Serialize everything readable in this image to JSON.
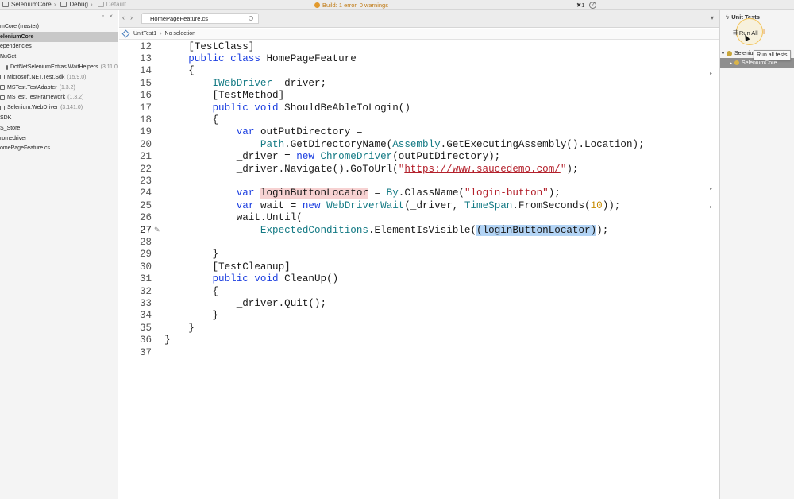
{
  "toolbar": {
    "solution": "SeleniumCore",
    "config": "Debug",
    "device": "Default",
    "build_status": "Build: 1 error, 0 warnings",
    "error_count": "1"
  },
  "solution_explorer": {
    "items": [
      {
        "label": "mCore (master)",
        "version": "",
        "indent": 0,
        "selected": false,
        "icon": ""
      },
      {
        "label": "eleniumCore",
        "version": "",
        "indent": 0,
        "selected": true,
        "icon": ""
      },
      {
        "label": "ependencies",
        "version": "",
        "indent": 0,
        "selected": false,
        "icon": ""
      },
      {
        "label": "NuGet",
        "version": "",
        "indent": 0,
        "selected": false,
        "icon": ""
      },
      {
        "label": "DotNetSeleniumExtras.WaitHelpers",
        "version": "(3.11.0)",
        "indent": 8,
        "selected": false,
        "icon": "package-icon"
      },
      {
        "label": "Microsoft.NET.Test.Sdk",
        "version": "(15.9.0)",
        "indent": 0,
        "selected": false,
        "icon": "package-icon"
      },
      {
        "label": "MSTest.TestAdapter",
        "version": "(1.3.2)",
        "indent": 0,
        "selected": false,
        "icon": "package-icon"
      },
      {
        "label": "MSTest.TestFramework",
        "version": "(1.3.2)",
        "indent": 0,
        "selected": false,
        "icon": "package-icon"
      },
      {
        "label": "Selenium.WebDriver",
        "version": "(3.141.0)",
        "indent": 0,
        "selected": false,
        "icon": "package-icon"
      },
      {
        "label": "SDK",
        "version": "",
        "indent": 0,
        "selected": false,
        "icon": ""
      },
      {
        "label": "S_Store",
        "version": "",
        "indent": 0,
        "selected": false,
        "icon": ""
      },
      {
        "label": "romedriver",
        "version": "",
        "indent": 0,
        "selected": false,
        "icon": ""
      },
      {
        "label": "omePageFeature.cs",
        "version": "",
        "indent": 0,
        "selected": false,
        "icon": ""
      }
    ]
  },
  "editor": {
    "tab_title": "HomePageFeature.cs",
    "breadcrumb": [
      "UnitTest1",
      "No selection"
    ],
    "current_line": 27,
    "lines": [
      {
        "n": "12",
        "code": [
          [
            "",
            "    "
          ],
          [
            "",
            "[TestClass]"
          ]
        ]
      },
      {
        "n": "13",
        "code": [
          [
            "",
            "    "
          ],
          [
            "kw",
            "public class "
          ],
          [
            "",
            "HomePageFeature"
          ]
        ]
      },
      {
        "n": "14",
        "code": [
          [
            "",
            "    {"
          ]
        ]
      },
      {
        "n": "15",
        "code": [
          [
            "",
            "        "
          ],
          [
            "ty",
            "IWebDriver"
          ],
          [
            "",
            " _driver;"
          ]
        ]
      },
      {
        "n": "16",
        "code": [
          [
            "",
            "        [TestMethod]"
          ]
        ]
      },
      {
        "n": "17",
        "code": [
          [
            "",
            "        "
          ],
          [
            "kw",
            "public void "
          ],
          [
            "",
            "ShouldBeAbleToLogin()"
          ]
        ]
      },
      {
        "n": "18",
        "code": [
          [
            "",
            "        {"
          ]
        ]
      },
      {
        "n": "19",
        "code": [
          [
            "",
            "            "
          ],
          [
            "kw",
            "var "
          ],
          [
            "",
            "outPutDirectory ="
          ]
        ]
      },
      {
        "n": "20",
        "code": [
          [
            "",
            "                "
          ],
          [
            "ty",
            "Path"
          ],
          [
            "",
            ".GetDirectoryName("
          ],
          [
            "ty",
            "Assembly"
          ],
          [
            "",
            ".GetExecutingAssembly().Location);"
          ]
        ]
      },
      {
        "n": "21",
        "code": [
          [
            "",
            "            _driver = "
          ],
          [
            "kw",
            "new "
          ],
          [
            "ty",
            "ChromeDriver"
          ],
          [
            "",
            "(outPutDirectory);"
          ]
        ]
      },
      {
        "n": "22",
        "code": [
          [
            "",
            "            _driver.Navigate().GoToUrl("
          ],
          [
            "str",
            "\""
          ],
          [
            "url",
            "https://www.saucedemo.com/"
          ],
          [
            "str",
            "\""
          ],
          [
            "",
            ");"
          ]
        ]
      },
      {
        "n": "23",
        "code": [
          [
            "",
            ""
          ]
        ]
      },
      {
        "n": "24",
        "code": [
          [
            "",
            "            "
          ],
          [
            "kw",
            "var "
          ],
          [
            "hl-red",
            "loginButtonLocator"
          ],
          [
            "",
            " = "
          ],
          [
            "ty",
            "By"
          ],
          [
            "",
            ".ClassName("
          ],
          [
            "str",
            "\"login-button\""
          ],
          [
            "",
            ");"
          ]
        ]
      },
      {
        "n": "25",
        "code": [
          [
            "",
            "            "
          ],
          [
            "kw",
            "var "
          ],
          [
            "",
            "wait = "
          ],
          [
            "kw",
            "new "
          ],
          [
            "ty",
            "WebDriverWait"
          ],
          [
            "",
            "(_driver, "
          ],
          [
            "ty",
            "TimeSpan"
          ],
          [
            "",
            ".FromSeconds("
          ],
          [
            "num",
            "10"
          ],
          [
            "",
            "));"
          ]
        ]
      },
      {
        "n": "26",
        "code": [
          [
            "",
            "            wait.Until("
          ]
        ]
      },
      {
        "n": "27",
        "code": [
          [
            "",
            "                "
          ],
          [
            "ty",
            "ExpectedConditions"
          ],
          [
            "",
            ".ElementIsVisible("
          ],
          [
            "hl-blue",
            "(loginButtonLocator)"
          ],
          [
            "",
            ");"
          ]
        ]
      },
      {
        "n": "28",
        "code": [
          [
            "",
            ""
          ]
        ]
      },
      {
        "n": "29",
        "code": [
          [
            "",
            "        }"
          ]
        ]
      },
      {
        "n": "30",
        "code": [
          [
            "",
            "        [TestCleanup]"
          ]
        ]
      },
      {
        "n": "31",
        "code": [
          [
            "",
            "        "
          ],
          [
            "kw",
            "public void "
          ],
          [
            "",
            "CleanUp()"
          ]
        ]
      },
      {
        "n": "32",
        "code": [
          [
            "",
            "        {"
          ]
        ]
      },
      {
        "n": "33",
        "code": [
          [
            "",
            "            _driver.Quit();"
          ]
        ]
      },
      {
        "n": "34",
        "code": [
          [
            "",
            "        }"
          ]
        ]
      },
      {
        "n": "35",
        "code": [
          [
            "",
            "    }"
          ]
        ]
      },
      {
        "n": "36",
        "code": [
          [
            "",
            "}"
          ]
        ]
      },
      {
        "n": "37",
        "code": [
          [
            "",
            ""
          ]
        ]
      }
    ]
  },
  "unit_tests": {
    "title": "Unit Tests",
    "run_all_label": "Run All",
    "tooltip": "Run all tests",
    "tree": [
      {
        "label": "Selenium",
        "selected": false
      },
      {
        "label": "SeleniumCore",
        "selected": true
      }
    ]
  },
  "colors": {
    "keyword": "#1c3fe0",
    "type": "#147a84",
    "string": "#b3202b",
    "number": "#c78b00",
    "warning": "#e29a2e"
  }
}
